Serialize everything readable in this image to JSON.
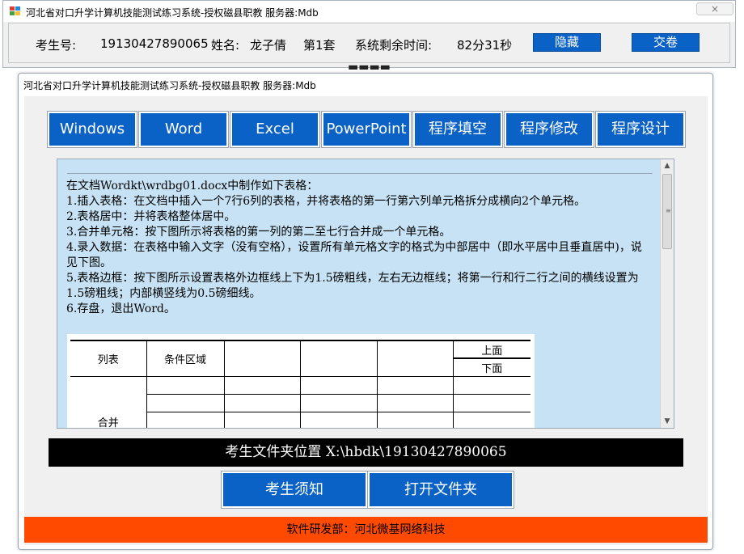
{
  "top_window": {
    "title": "河北省对口升学计算机技能测试练习系统-授权磁县职教  服务器:Mdb",
    "close_label": "×",
    "exam_id_label": "考生号:",
    "exam_id": "19130427890065",
    "name_label": "姓名:",
    "name": "龙子倩",
    "set": "第1套",
    "time_label": "系统剩余时间:",
    "time_remaining": "82分31秒",
    "hide_button": "隐藏",
    "submit_button": "交卷"
  },
  "main_window": {
    "title": "河北省对口升学计算机技能测试练习系统-授权磁县职教  服务器:Mdb",
    "tabs": [
      "Windows",
      "Word",
      "Excel",
      "PowerPoint",
      "程序填空",
      "程序修改",
      "程序设计"
    ],
    "instructions": [
      "在文档Wordkt\\wrdbg01.docx中制作如下表格：",
      "1.插入表格：在文档中插入一个7行6列的表格，并将表格的第一行第六列单元格拆分成横向2个单元格。",
      "2.表格居中：并将表格整体居中。",
      "3.合并单元格：按下图所示将表格的第一列的第二至七行合并成一个单元格。",
      "4.录入数据：在表格中输入文字（没有空格），设置所有单元格文字的格式为中部居中（即水平居中且垂直居中)，说见下图。",
      "5.表格边框：按下图所示设置表格外边框线上下为1.5磅粗线，左右无边框线；将第一行和行二行之间的横线设置为1.5磅粗线；内部横竖线为0.5磅细线。",
      "6.存盘，退出Word。"
    ],
    "table_preview": {
      "col1": "列表",
      "col2": "条件区域",
      "split_top": "上面",
      "split_bottom": "下面",
      "merged_partial": "合并"
    },
    "folder_path": "考生文件夹位置 X:\\hbdk\\19130427890065",
    "notice_button": "考生须知",
    "open_folder_button": "打开文件夹",
    "footer": "软件研发部：河北微基网络科技"
  },
  "colors": {
    "button_blue": "#0b62c6",
    "content_bg": "#c6e2f4",
    "footer_orange": "#ff4a00"
  }
}
